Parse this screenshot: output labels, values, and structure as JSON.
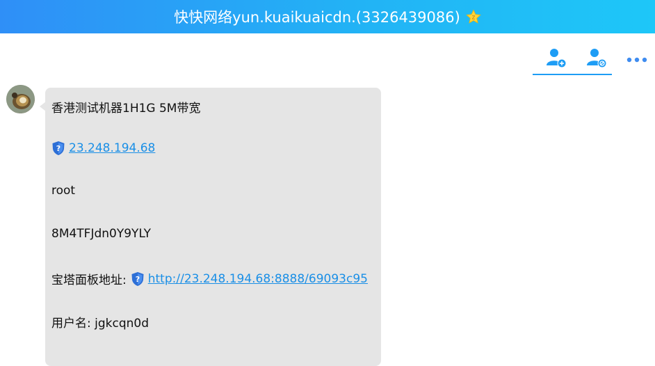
{
  "window": {
    "title": "快快网络yun.kuaikuaicdn.(3326439086)",
    "title_badge_icon": "star-badge-icon"
  },
  "toolbar": {
    "items": [
      {
        "name": "add-friend-button",
        "icon": "user-add-icon"
      },
      {
        "name": "block-user-button",
        "icon": "user-block-icon"
      },
      {
        "name": "more-button",
        "icon": "more-dots-icon"
      }
    ],
    "accent_color": "#1e9df5"
  },
  "message": {
    "line1": "香港测试机器1H1G 5M带宽",
    "ip_link": "23.248.194.68",
    "username_value": "root",
    "password_value": "8M4TFJdn0Y9YLY",
    "panel_label": "宝塔面板地址: ",
    "panel_link": "http://23.248.194.68:8888/69093c95",
    "panel_user": "用户名: jgkcqn0d"
  },
  "colors": {
    "titlebar_start": "#2f8ff7",
    "titlebar_end": "#1ec7f8",
    "bubble_bg": "#e5e5e5",
    "link": "#1a8fe6"
  }
}
